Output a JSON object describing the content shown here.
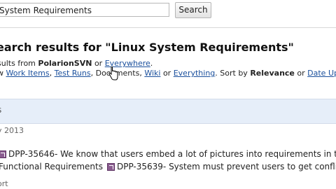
{
  "search": {
    "query": "System Requirements",
    "button_label": "Search"
  },
  "results": {
    "title": "earch results for \"Linux System Requirements\"",
    "from_prefix": "sults from",
    "repo_name": "PolarionSVN",
    "or1": "or",
    "everywhere_link": "Everywhere",
    "period": ".",
    "show_prefix": "w",
    "filter_work_items": "Work Items",
    "comma1": ",",
    "filter_test_runs": "Test Runs",
    "comma2": ",",
    "filter_documents": "Documents",
    "comma3": ",",
    "filter_wiki": "Wiki",
    "or2": "or",
    "filter_everything": "Everything",
    "sort_text": ". Sort by",
    "sort_relevance": "Relevance",
    "or3": "or",
    "sort_date": "Date Update"
  },
  "band": {
    "text": "s"
  },
  "date": {
    "text": "y 2013"
  },
  "items": [
    {
      "prefix": "",
      "id": "DPP-35646",
      "text": " - We know that users embed a lot of pictures into requirements in the re"
    },
    {
      "prefix": " Functional Requirements",
      "id": "DPP-35639",
      "text": " - System must prevent users to get conflict m"
    }
  ],
  "bottom": {
    "text": "ort"
  }
}
